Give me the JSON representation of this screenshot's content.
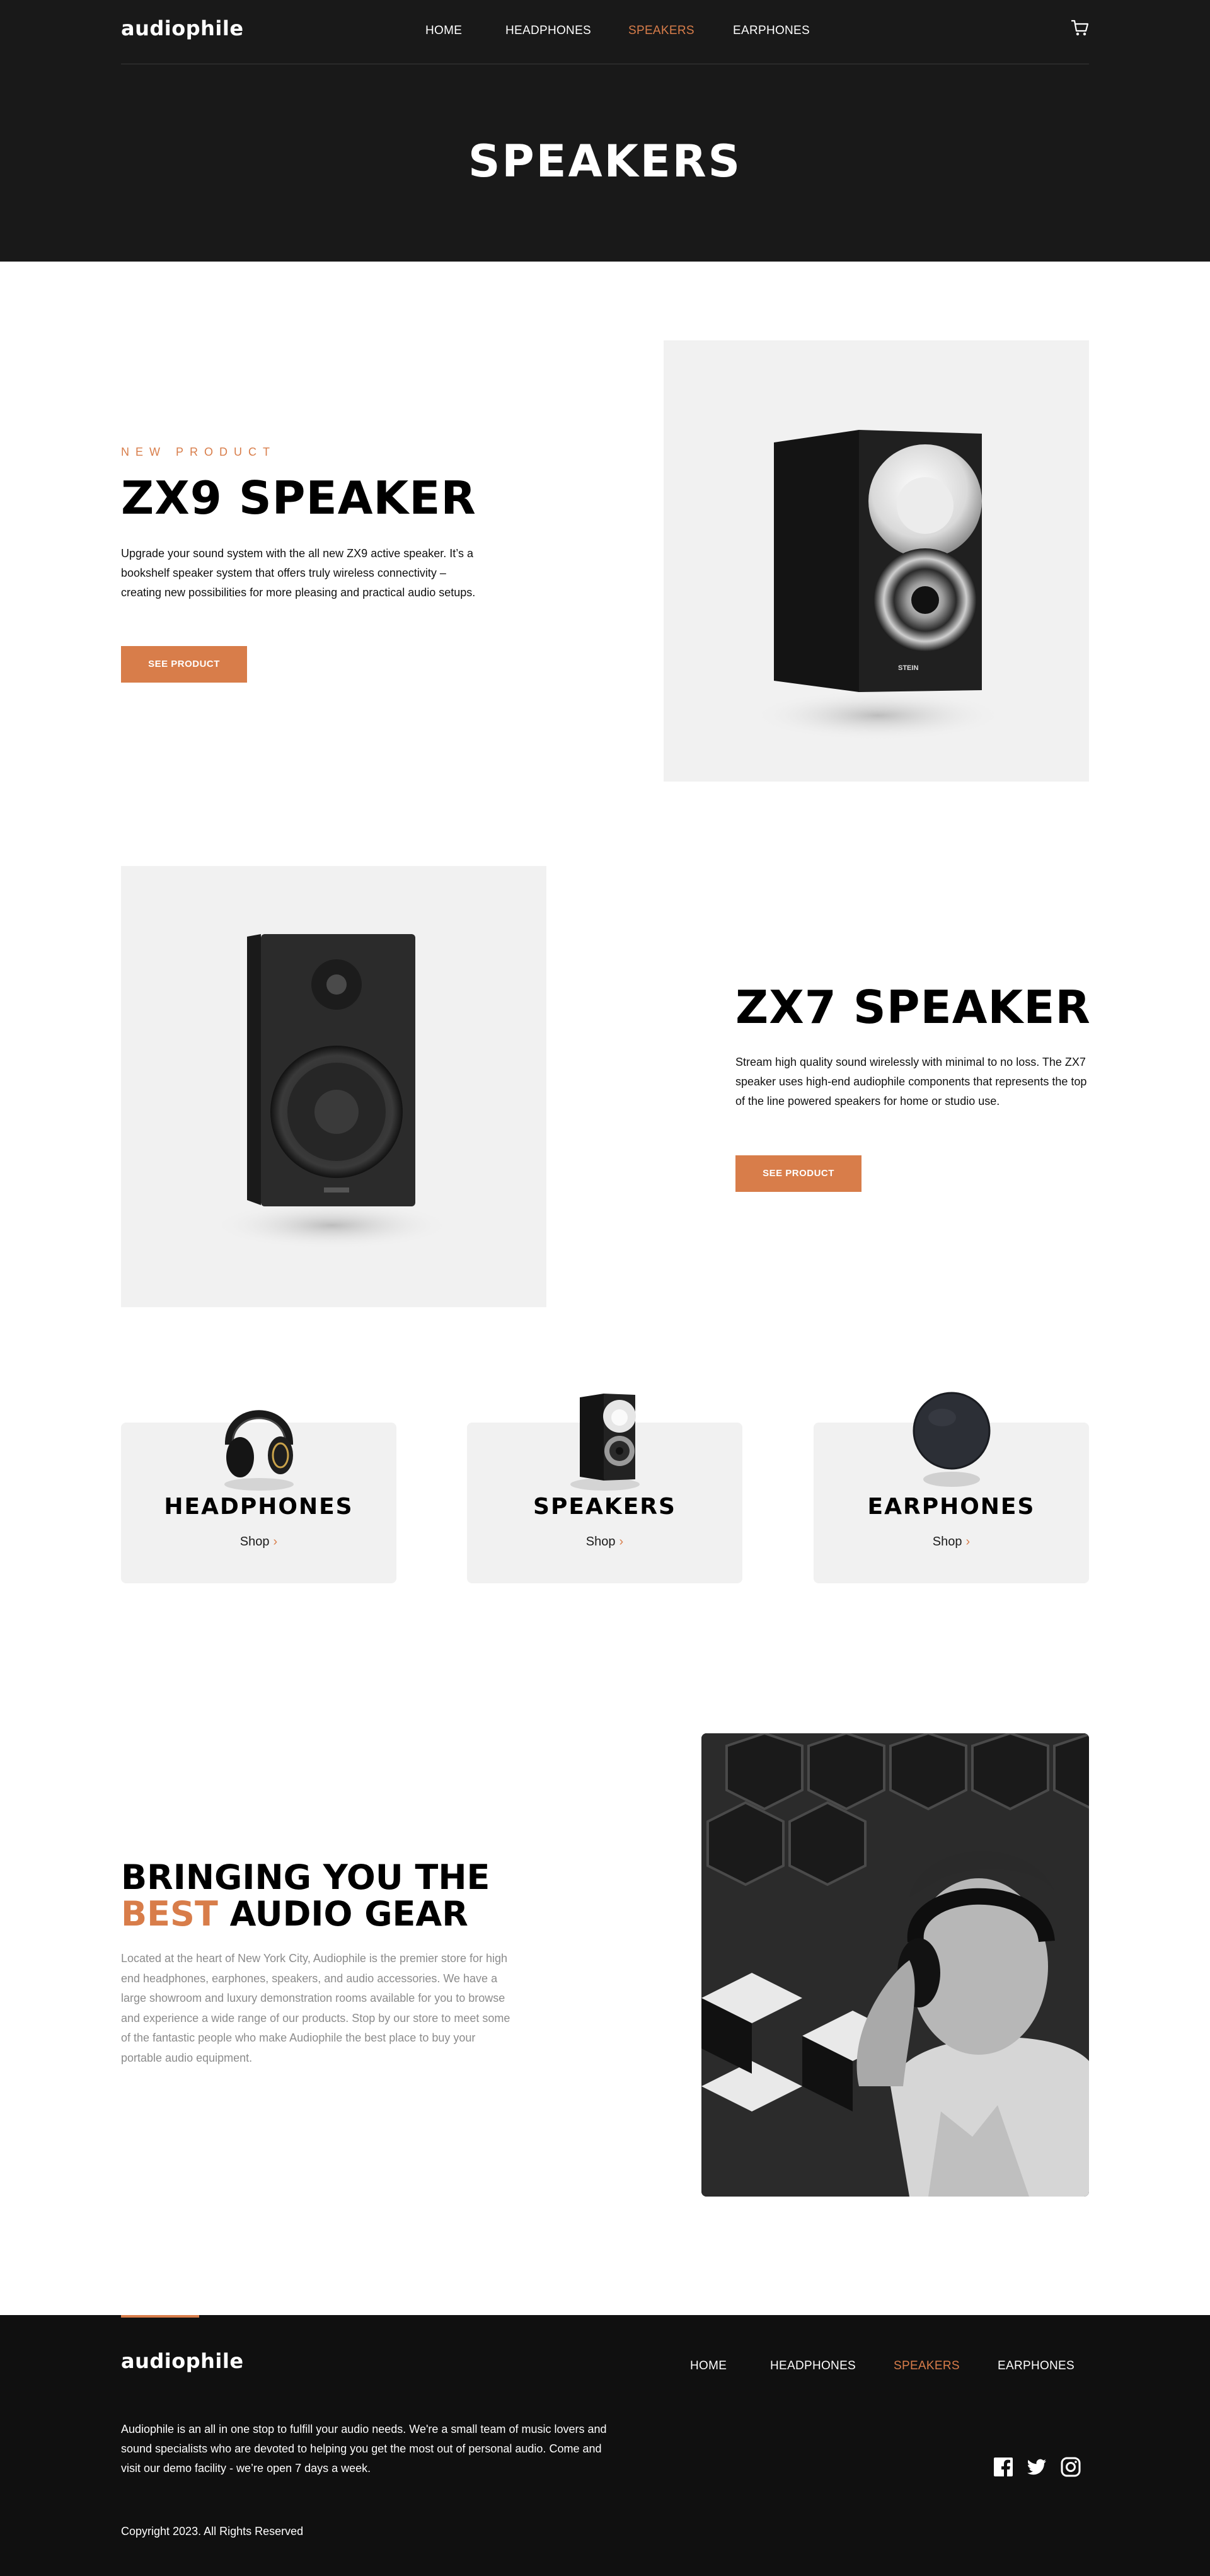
{
  "header": {
    "logo": "audiophile",
    "nav": [
      "HOME",
      "HEADPHONES",
      "SPEAKERS",
      "EARPHONES"
    ],
    "active_nav": "SPEAKERS",
    "cart_icon": "cart-icon"
  },
  "hero": {
    "title": "SPEAKERS"
  },
  "products": [
    {
      "overline": "NEW PRODUCT",
      "title": "ZX9 SPEAKER",
      "description": "Upgrade your sound system with the all new ZX9 active speaker. It’s a bookshelf speaker system that offers truly wireless connectivity – creating new possibilities for more pleasing and practical audio setups.",
      "button": "SEE PRODUCT"
    },
    {
      "title": "ZX7 SPEAKER",
      "description": "Stream high quality sound wirelessly with minimal to no loss. The ZX7 speaker uses high-end audiophile components that represents the top of the line powered speakers for home or studio use.",
      "button": "SEE PRODUCT"
    }
  ],
  "categories": [
    {
      "title": "HEADPHONES",
      "shop": "Shop"
    },
    {
      "title": "SPEAKERS",
      "shop": "Shop"
    },
    {
      "title": "EARPHONES",
      "shop": "Shop"
    }
  ],
  "about": {
    "title_line1": "BRINGING YOU THE",
    "title_accent": "BEST",
    "title_rest": "AUDIO GEAR",
    "description": "Located at the heart of New York City, Audiophile is the premier store for high end headphones, earphones, speakers, and audio accessories. We have a large showroom and luxury demonstration rooms available for you to browse and experience a wide range of our products. Stop by our store to meet some of the fantastic people who make Audiophile the best place to buy your portable audio equipment."
  },
  "footer": {
    "logo": "audiophile",
    "nav": [
      "HOME",
      "HEADPHONES",
      "SPEAKERS",
      "EARPHONES"
    ],
    "description": "Audiophile is an all in one stop to fulfill your audio needs. We're a small team of music lovers and sound specialists who are devoted to helping you get the most out of personal audio. Come and visit our demo facility - we’re open 7 days a week.",
    "copyright": "Copyright 2023. All Rights Reserved",
    "social_icons": [
      "facebook-icon",
      "twitter-icon",
      "instagram-icon"
    ]
  },
  "colors": {
    "accent": "#d87d4a",
    "dark": "#191919",
    "light_gray": "#f1f1f1"
  }
}
